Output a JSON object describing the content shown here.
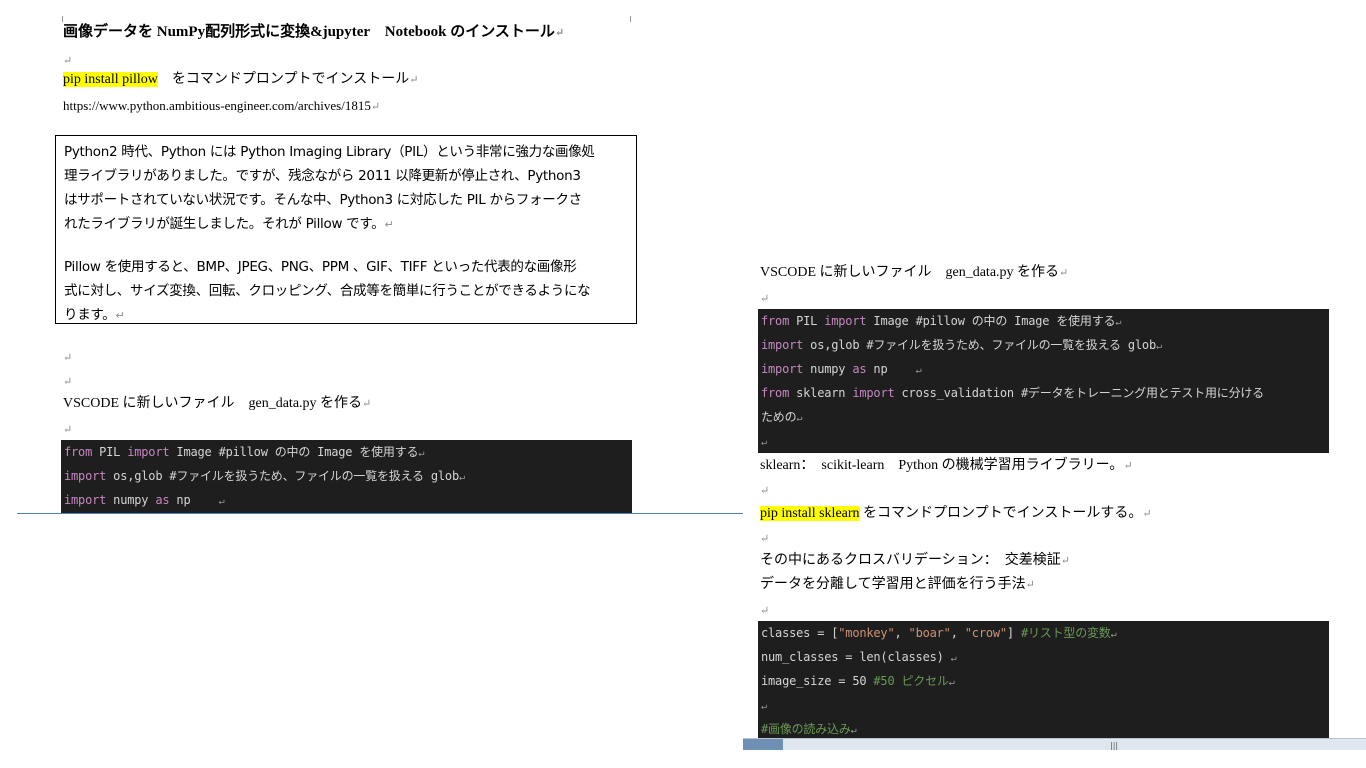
{
  "pilcrow": "↵",
  "left": {
    "title": "画像データを NumPy配列形式に変換&jupyter　Notebook のインストール",
    "pip_pillow_cmd": "pip install pillow",
    "pip_pillow_rest": "　をコマンドプロンプトでインストール",
    "url": "https://www.python.ambitious-engineer.com/archives/1815",
    "quote_lines": [
      "Python2 時代、Python には Python Imaging Library（PIL）という非常に強力な画像処",
      "理ライブラリがありました。ですが、残念ながら 2011 以降更新が停止され、Python3",
      "はサポートされていない状況です。そんな中、Python3 に対応した PIL からフォークさ",
      "れたライブラリが誕生しました。それが Pillow です。",
      "",
      "Pillow を使用すると、BMP、JPEG、PNG、PPM 、GIF、TIFF といった代表的な画像形",
      "式に対し、サイズ変換、回転、クロッピング、合成等を簡単に行うことができるようにな",
      "ります。"
    ],
    "vscode_heading": "VSCODE に新しいファイル　gen_data.py を作る",
    "code1": {
      "l1_from": "from",
      "l1_mod": " PIL ",
      "l1_import": "import",
      "l1_rest": " Image  #pillow の中の Image を使用する",
      "l2_import": "import",
      "l2_rest": " os,glob  #ファイルを扱うため、ファイルの一覧を扱える glob",
      "l3_import": "import",
      "l3_mod": " numpy ",
      "l3_as": "as",
      "l3_rest": " np"
    }
  },
  "right": {
    "vscode_heading": "VSCODE に新しいファイル　gen_data.py を作る",
    "code2": {
      "l1_from": "from",
      "l1_mod": " PIL ",
      "l1_import": "import",
      "l1_rest": " Image  #pillow の中の Image を使用する",
      "l2_import": "import",
      "l2_rest": " os,glob  #ファイルを扱うため、ファイルの一覧を扱える glob",
      "l3_import": "import",
      "l3_mod": " numpy ",
      "l3_as": "as",
      "l3_rest": " np",
      "l4_from": "from",
      "l4_mod": " sklearn ",
      "l4_import": "import",
      "l4_rest": " cross_validation  #データをトレーニング用とテスト用に分ける",
      "l5": "ための"
    },
    "sklearn_line": "sklearn：　scikit-learn　Python の機械学習用ライブラリー。",
    "pip_sklearn_cmd": "pip install sklearn",
    "pip_sklearn_rest": " をコマンドプロンプトでインストールする。",
    "cross_val_line": "その中にあるクロスバリデーション：　交差検証",
    "cross_val_desc": "データを分離して学習用と評価を行う手法",
    "code3": {
      "l1_pre": "classes = [",
      "l1_s1": "\"monkey\"",
      "l1_c1": ", ",
      "l1_s2": "\"boar\"",
      "l1_c2": ", ",
      "l1_s3": "\"crow\"",
      "l1_post": "] ",
      "l1_cm": "#リスト型の変数",
      "l2": "num_classes = len(classes)",
      "l3_pre": "image_size = 50 ",
      "l3_cm": "#50 ピクセル",
      "l5_cm": "#画像の読み込み"
    }
  },
  "colors": {
    "highlight": "#ffff00",
    "code_bg": "#1e1e1e",
    "keyword": "#c586c0",
    "string": "#ce9178",
    "comment": "#6a9955"
  }
}
